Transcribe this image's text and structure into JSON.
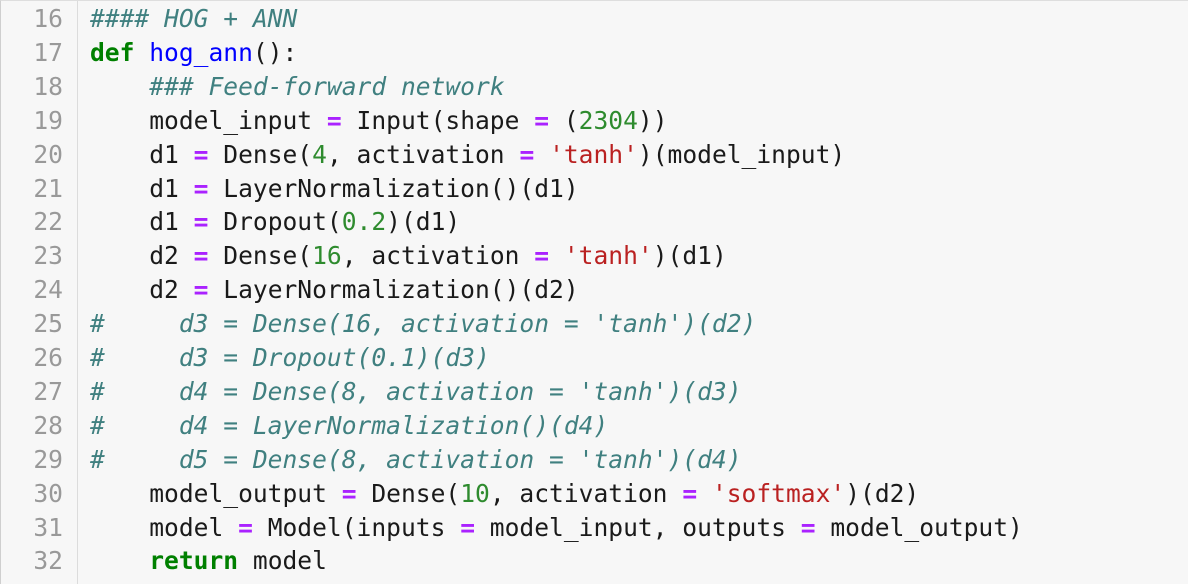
{
  "editor": {
    "lines": [
      {
        "n": "16",
        "tokens": [
          {
            "t": "#### HOG + ANN",
            "c": "cm"
          }
        ]
      },
      {
        "n": "17",
        "tokens": [
          {
            "t": "def",
            "c": "kw"
          },
          {
            "t": " ",
            "c": "tx"
          },
          {
            "t": "hog_ann",
            "c": "def"
          },
          {
            "t": "():",
            "c": "tx"
          }
        ]
      },
      {
        "n": "18",
        "tokens": [
          {
            "t": "    ",
            "c": "tx"
          },
          {
            "t": "### Feed-forward network",
            "c": "cm"
          }
        ]
      },
      {
        "n": "19",
        "tokens": [
          {
            "t": "    model_input ",
            "c": "tx"
          },
          {
            "t": "=",
            "c": "op"
          },
          {
            "t": " Input(shape ",
            "c": "tx"
          },
          {
            "t": "=",
            "c": "op"
          },
          {
            "t": " (",
            "c": "tx"
          },
          {
            "t": "2304",
            "c": "num"
          },
          {
            "t": "))",
            "c": "tx"
          }
        ]
      },
      {
        "n": "20",
        "tokens": [
          {
            "t": "    d1 ",
            "c": "tx"
          },
          {
            "t": "=",
            "c": "op"
          },
          {
            "t": " Dense(",
            "c": "tx"
          },
          {
            "t": "4",
            "c": "num"
          },
          {
            "t": ", activation ",
            "c": "tx"
          },
          {
            "t": "=",
            "c": "op"
          },
          {
            "t": " ",
            "c": "tx"
          },
          {
            "t": "'tanh'",
            "c": "str"
          },
          {
            "t": ")(model_input)",
            "c": "tx"
          }
        ]
      },
      {
        "n": "21",
        "tokens": [
          {
            "t": "    d1 ",
            "c": "tx"
          },
          {
            "t": "=",
            "c": "op"
          },
          {
            "t": " LayerNormalization()(d1)",
            "c": "tx"
          }
        ]
      },
      {
        "n": "22",
        "tokens": [
          {
            "t": "    d1 ",
            "c": "tx"
          },
          {
            "t": "=",
            "c": "op"
          },
          {
            "t": " Dropout(",
            "c": "tx"
          },
          {
            "t": "0.2",
            "c": "num"
          },
          {
            "t": ")(d1)",
            "c": "tx"
          }
        ]
      },
      {
        "n": "23",
        "tokens": [
          {
            "t": "    d2 ",
            "c": "tx"
          },
          {
            "t": "=",
            "c": "op"
          },
          {
            "t": " Dense(",
            "c": "tx"
          },
          {
            "t": "16",
            "c": "num"
          },
          {
            "t": ", activation ",
            "c": "tx"
          },
          {
            "t": "=",
            "c": "op"
          },
          {
            "t": " ",
            "c": "tx"
          },
          {
            "t": "'tanh'",
            "c": "str"
          },
          {
            "t": ")(d1)",
            "c": "tx"
          }
        ]
      },
      {
        "n": "24",
        "tokens": [
          {
            "t": "    d2 ",
            "c": "tx"
          },
          {
            "t": "=",
            "c": "op"
          },
          {
            "t": " LayerNormalization()(d2)",
            "c": "tx"
          }
        ]
      },
      {
        "n": "25",
        "tokens": [
          {
            "t": "#     d3 = Dense(16, activation = 'tanh')(d2)",
            "c": "cm"
          }
        ]
      },
      {
        "n": "26",
        "tokens": [
          {
            "t": "#     d3 = Dropout(0.1)(d3)",
            "c": "cm"
          }
        ]
      },
      {
        "n": "27",
        "tokens": [
          {
            "t": "#     d4 = Dense(8, activation = 'tanh')(d3)",
            "c": "cm"
          }
        ]
      },
      {
        "n": "28",
        "tokens": [
          {
            "t": "#     d4 = LayerNormalization()(d4)",
            "c": "cm"
          }
        ]
      },
      {
        "n": "29",
        "tokens": [
          {
            "t": "#     d5 = Dense(8, activation = 'tanh')(d4)",
            "c": "cm"
          }
        ]
      },
      {
        "n": "30",
        "tokens": [
          {
            "t": "    model_output ",
            "c": "tx"
          },
          {
            "t": "=",
            "c": "op"
          },
          {
            "t": " Dense(",
            "c": "tx"
          },
          {
            "t": "10",
            "c": "num"
          },
          {
            "t": ", activation ",
            "c": "tx"
          },
          {
            "t": "=",
            "c": "op"
          },
          {
            "t": " ",
            "c": "tx"
          },
          {
            "t": "'softmax'",
            "c": "str"
          },
          {
            "t": ")(d2)",
            "c": "tx"
          }
        ]
      },
      {
        "n": "31",
        "tokens": [
          {
            "t": "    model ",
            "c": "tx"
          },
          {
            "t": "=",
            "c": "op"
          },
          {
            "t": " Model(inputs ",
            "c": "tx"
          },
          {
            "t": "=",
            "c": "op"
          },
          {
            "t": " model_input, outputs ",
            "c": "tx"
          },
          {
            "t": "=",
            "c": "op"
          },
          {
            "t": " model_output)",
            "c": "tx"
          }
        ]
      },
      {
        "n": "32",
        "tokens": [
          {
            "t": "    ",
            "c": "tx"
          },
          {
            "t": "return",
            "c": "kw"
          },
          {
            "t": " model",
            "c": "tx"
          }
        ]
      }
    ]
  }
}
